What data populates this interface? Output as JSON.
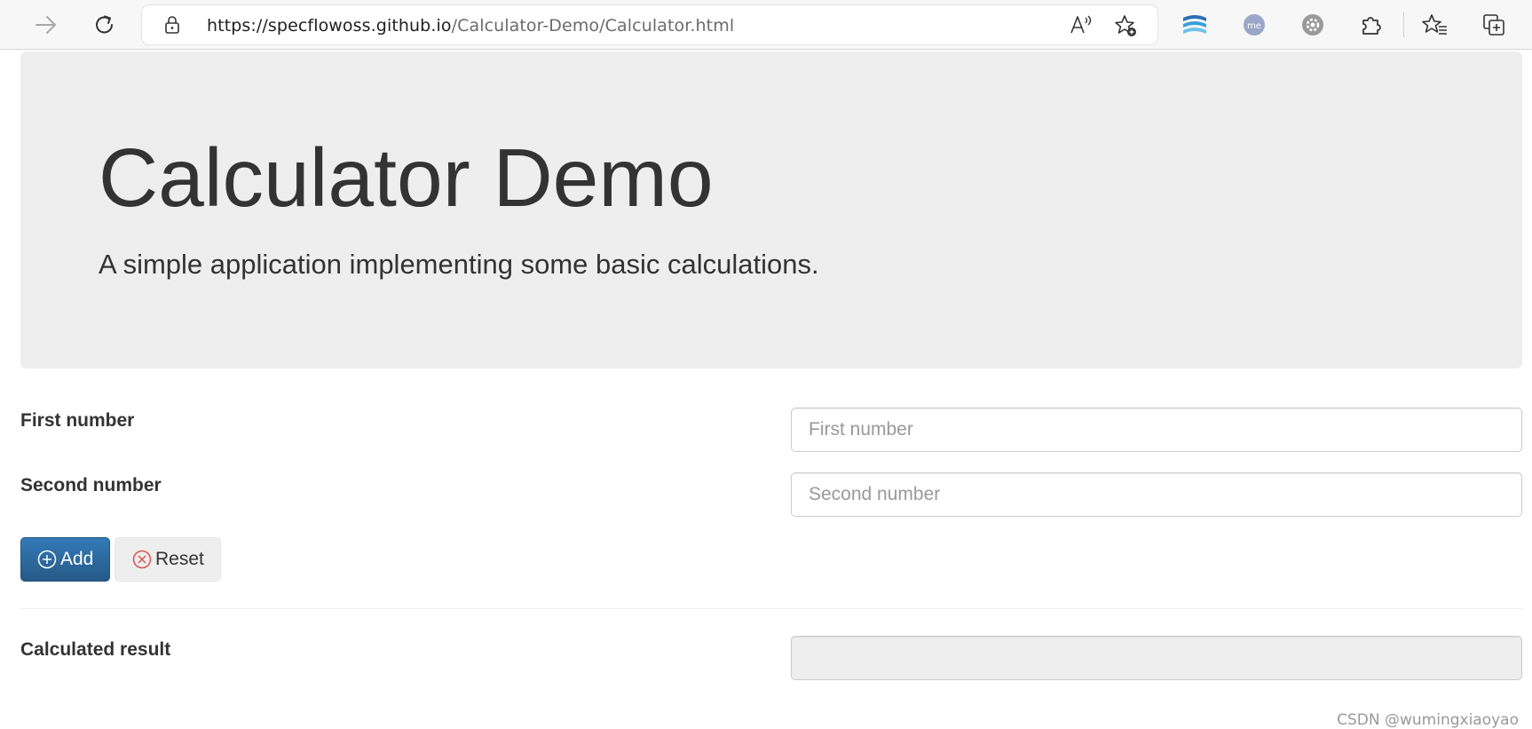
{
  "browser": {
    "url_host": "https://specflowoss.github.io",
    "url_path": "/Calculator-Demo/Calculator.html",
    "icons": [
      "forward-icon",
      "refresh-icon",
      "lock-icon",
      "read-aloud-icon",
      "add-favorite-icon",
      "extension-stripes-icon",
      "extension-me-icon",
      "extension-gear-icon",
      "extensions-puzzle-icon",
      "favorites-icon",
      "collections-icon"
    ],
    "me_badge": "me"
  },
  "page": {
    "title": "Calculator Demo",
    "subtitle": "A simple application implementing some basic calculations.",
    "first_number_label": "First number",
    "first_number_placeholder": "First number",
    "second_number_label": "Second number",
    "second_number_placeholder": "Second number",
    "add_label": "Add",
    "reset_label": "Reset",
    "result_label": "Calculated result",
    "result_value": ""
  },
  "watermark": "CSDN @wumingxiaoyao",
  "colors": {
    "primary": "#337ab7",
    "jumbotron_bg": "#eeeeee",
    "reset_icon": "#d9534f"
  }
}
